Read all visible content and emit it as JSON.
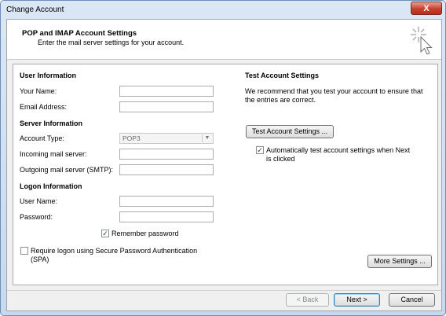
{
  "window": {
    "title": "Change Account",
    "close_glyph": "X"
  },
  "header": {
    "title": "POP and IMAP Account Settings",
    "subtitle": "Enter the mail server settings for your account.",
    "icon": "cursor-sparkle-icon"
  },
  "user_info": {
    "heading": "User Information",
    "your_name_label": "Your Name:",
    "your_name_value": "",
    "email_label": "Email Address:",
    "email_value": ""
  },
  "server_info": {
    "heading": "Server Information",
    "account_type_label": "Account Type:",
    "account_type_value": "POP3",
    "incoming_label": "Incoming mail server:",
    "incoming_value": "",
    "outgoing_label": "Outgoing mail server (SMTP):",
    "outgoing_value": ""
  },
  "logon_info": {
    "heading": "Logon Information",
    "user_name_label": "User Name:",
    "user_name_value": "",
    "password_label": "Password:",
    "password_value": "",
    "remember_password_label": "Remember password",
    "remember_password_checked": true,
    "spa_label_line1": "Require logon using Secure Password Authentication",
    "spa_label_line2": "(SPA)",
    "spa_checked": false
  },
  "test_settings": {
    "heading": "Test Account Settings",
    "description_line1": "We recommend that you test your account to ensure that",
    "description_line2": "the entries are correct.",
    "test_button": "Test Account Settings ...",
    "auto_test_line1": "Automatically test account settings when Next",
    "auto_test_line2": "is clicked",
    "auto_test_checked": true
  },
  "buttons": {
    "more_settings": "More Settings ...",
    "back": "< Back",
    "next": "Next >",
    "cancel": "Cancel"
  },
  "colors": {
    "accent": "#3c7fb1",
    "close": "#c7402d",
    "frame": "#c8d9ee"
  }
}
